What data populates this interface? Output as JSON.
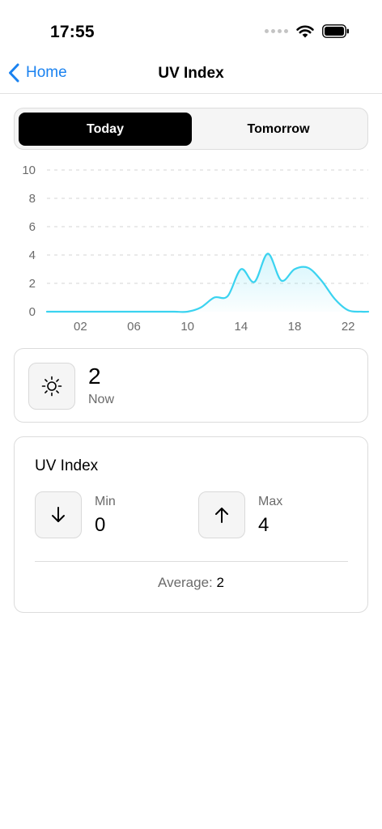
{
  "status_bar": {
    "time": "17:55"
  },
  "nav": {
    "back_label": "Home",
    "title": "UV Index"
  },
  "segmented": {
    "options": [
      "Today",
      "Tomorrow"
    ],
    "selected": "Today"
  },
  "colors": {
    "accent": "#1a82f0",
    "line": "#3bd3f0",
    "selected_segment": "#000000"
  },
  "chart_data": {
    "type": "area",
    "x": [
      0,
      1,
      2,
      3,
      4,
      5,
      6,
      7,
      8,
      9,
      10,
      11,
      12,
      13,
      14,
      15,
      16,
      17,
      18,
      19,
      20,
      21,
      22,
      23
    ],
    "values": [
      0,
      0,
      0,
      0,
      0,
      0,
      0,
      0,
      0,
      0,
      0,
      0.3,
      1.0,
      1.1,
      3.0,
      2.1,
      4.1,
      2.2,
      3.0,
      3.1,
      2.2,
      0.9,
      0.1,
      0
    ],
    "xtick_labels": [
      "02",
      "06",
      "10",
      "14",
      "18",
      "22"
    ],
    "xtick_values": [
      2,
      6,
      10,
      14,
      18,
      22
    ],
    "yticks": [
      0,
      2,
      4,
      6,
      8,
      10
    ],
    "ylim": [
      0,
      10
    ],
    "xlim": [
      -0.5,
      23.5
    ],
    "grid": true,
    "legend": false
  },
  "now": {
    "icon": "sun-icon",
    "value": "2",
    "label": "Now"
  },
  "uv_summary": {
    "title": "UV Index",
    "min_label": "Min",
    "min_value": "0",
    "max_label": "Max",
    "max_value": "4",
    "average_label": "Average:",
    "average_value": "2"
  }
}
